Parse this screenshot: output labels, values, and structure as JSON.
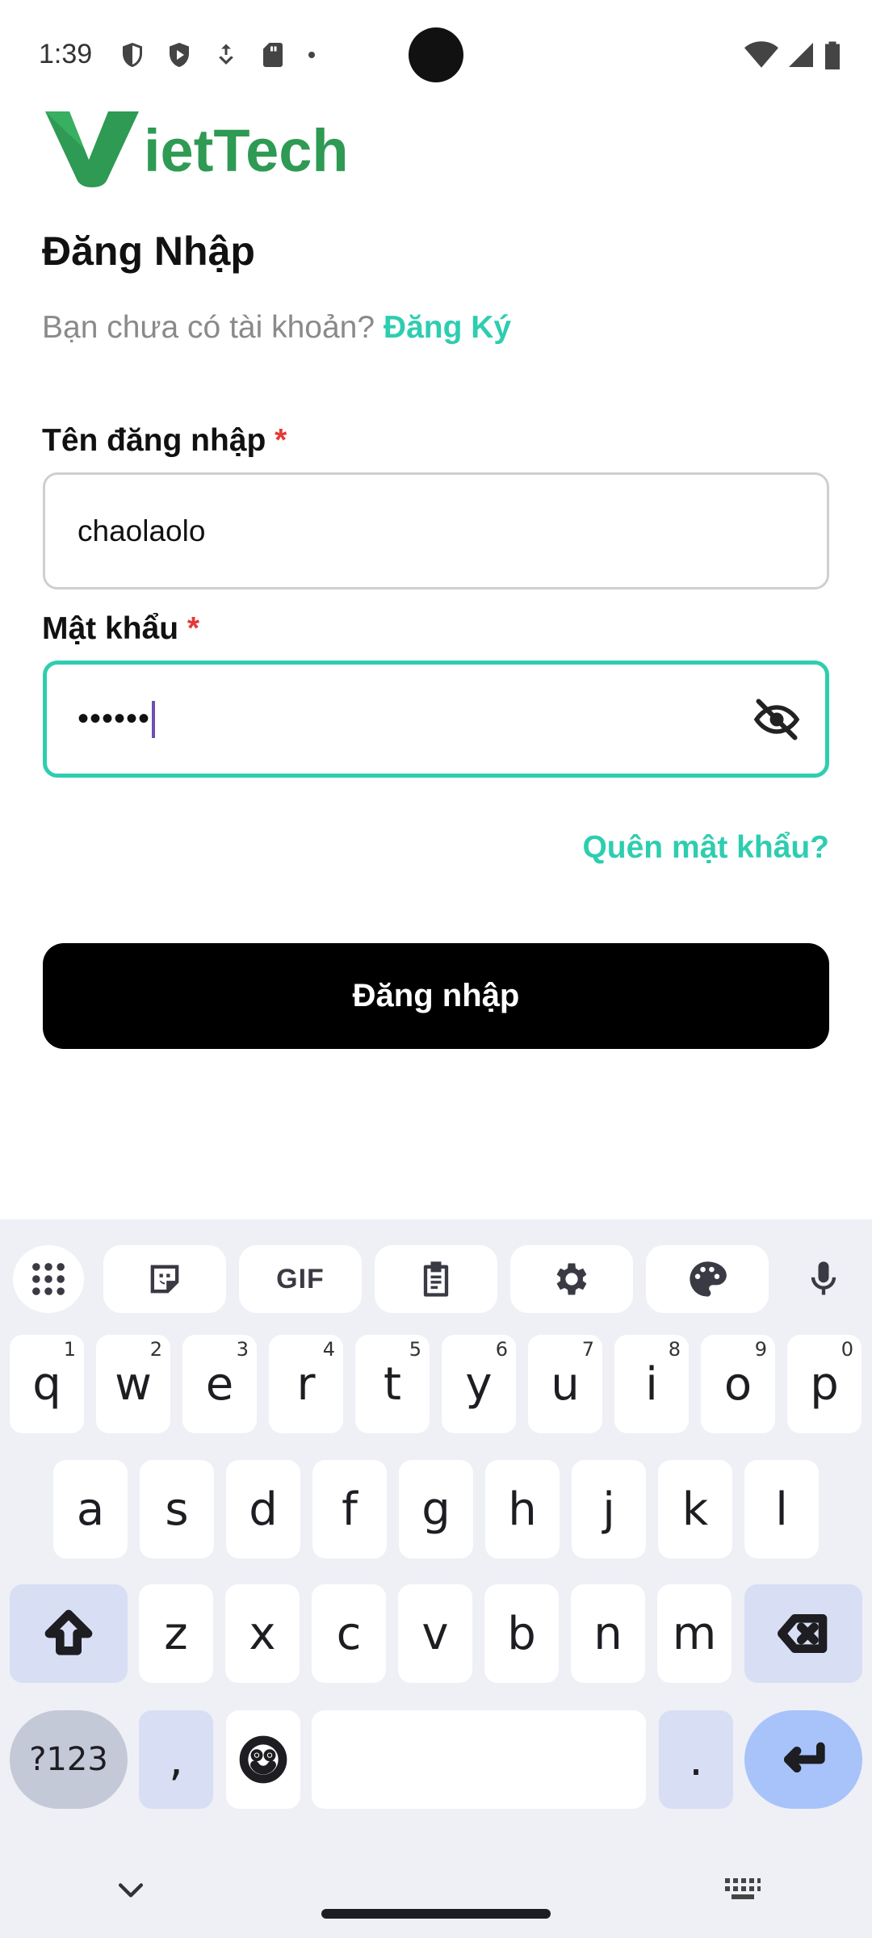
{
  "status_bar": {
    "time": "1:39",
    "icons_left": [
      "shield-icon",
      "shield-play-icon",
      "download-icon",
      "sd-card-icon",
      "dot-icon"
    ],
    "icons_right": [
      "wifi-icon",
      "signal-icon",
      "battery-icon"
    ]
  },
  "logo": {
    "mark": "V",
    "text": "ietTech",
    "color": "#2e9a53"
  },
  "login": {
    "title": "Đăng Nhập",
    "signup_prompt": "Bạn chưa có tài khoản?",
    "signup_link": "Đăng Ký",
    "username_label": "Tên đăng nhập",
    "username_value": "chaolaolo",
    "password_label": "Mật khẩu",
    "password_value": "••••••",
    "required_mark": "*",
    "forgot_link": "Quên mật khẩu?",
    "login_button": "Đăng nhập",
    "accent_color": "#2ecdb0"
  },
  "keyboard": {
    "toolbar": [
      "apps-grid-icon",
      "sticker-icon",
      "GIF",
      "clipboard-icon",
      "settings-icon",
      "palette-icon",
      "mic-icon"
    ],
    "row1": [
      {
        "k": "q",
        "h": "1"
      },
      {
        "k": "w",
        "h": "2"
      },
      {
        "k": "e",
        "h": "3"
      },
      {
        "k": "r",
        "h": "4"
      },
      {
        "k": "t",
        "h": "5"
      },
      {
        "k": "y",
        "h": "6"
      },
      {
        "k": "u",
        "h": "7"
      },
      {
        "k": "i",
        "h": "8"
      },
      {
        "k": "o",
        "h": "9"
      },
      {
        "k": "p",
        "h": "0"
      }
    ],
    "row2": [
      "a",
      "s",
      "d",
      "f",
      "g",
      "h",
      "j",
      "k",
      "l"
    ],
    "row3": [
      "z",
      "x",
      "c",
      "v",
      "b",
      "n",
      "m"
    ],
    "symbols_key": "?123",
    "comma_key": ",",
    "period_key": "."
  }
}
